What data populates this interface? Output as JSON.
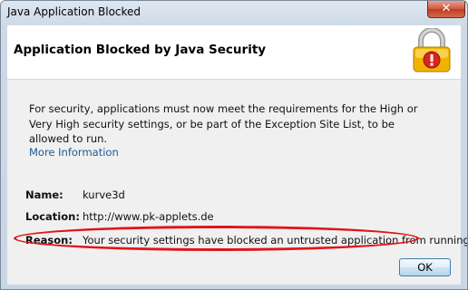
{
  "window": {
    "title": "Java Application Blocked",
    "close_label": "✕"
  },
  "header": {
    "title": "Application Blocked by Java Security",
    "icon": "lock-warning-icon"
  },
  "message": "For security, applications must now meet the requirements for the High or Very High security settings, or be part of the Exception Site List, to be allowed to run.",
  "more_info_label": "More Information",
  "details": {
    "name_label": "Name:",
    "name_value": "kurve3d",
    "location_label": "Location:",
    "location_value": "http://www.pk-applets.de",
    "reason_label": "Reason:",
    "reason_value": "Your security settings have blocked an untrusted application from running"
  },
  "ok_label": "OK",
  "colors": {
    "highlight": "#e0151b",
    "link": "#1c5a96"
  }
}
